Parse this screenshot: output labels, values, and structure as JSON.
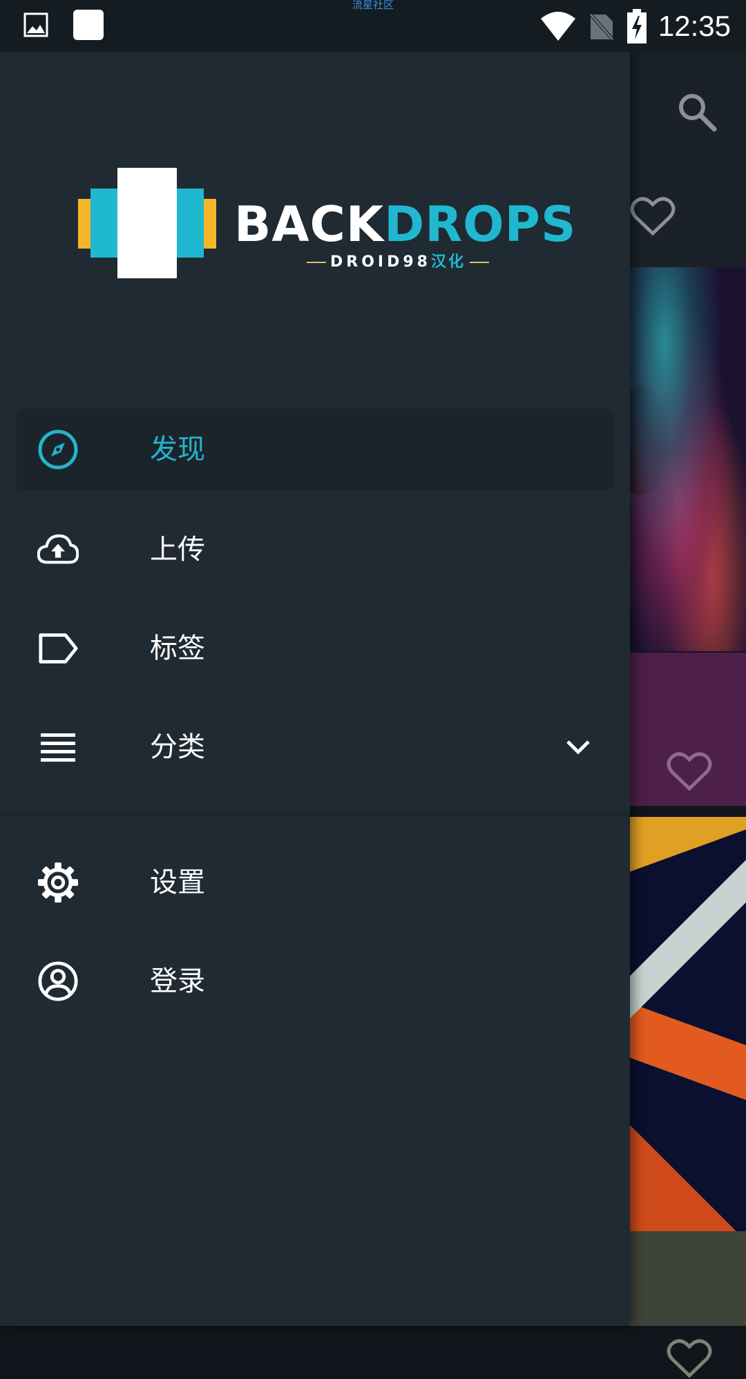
{
  "status_bar": {
    "center_label": "流星社区",
    "time": "12:35"
  },
  "logo": {
    "back": "BACK",
    "drops": "DROPS",
    "sub_left": "DROID98",
    "sub_right": "汉化"
  },
  "nav": {
    "items": [
      {
        "label": "发现",
        "icon": "compass-icon",
        "active": true
      },
      {
        "label": "上传",
        "icon": "cloud-upload-icon",
        "active": false
      },
      {
        "label": "标签",
        "icon": "tag-icon",
        "active": false
      },
      {
        "label": "分类",
        "icon": "list-icon",
        "active": false
      }
    ],
    "secondary": [
      {
        "label": "设置",
        "icon": "gear-icon"
      },
      {
        "label": "登录",
        "icon": "account-circle-icon"
      }
    ]
  },
  "colors": {
    "accent": "#22b6cc",
    "drawer_bg": "#202a32",
    "logo_yellow": "#f5b629"
  }
}
